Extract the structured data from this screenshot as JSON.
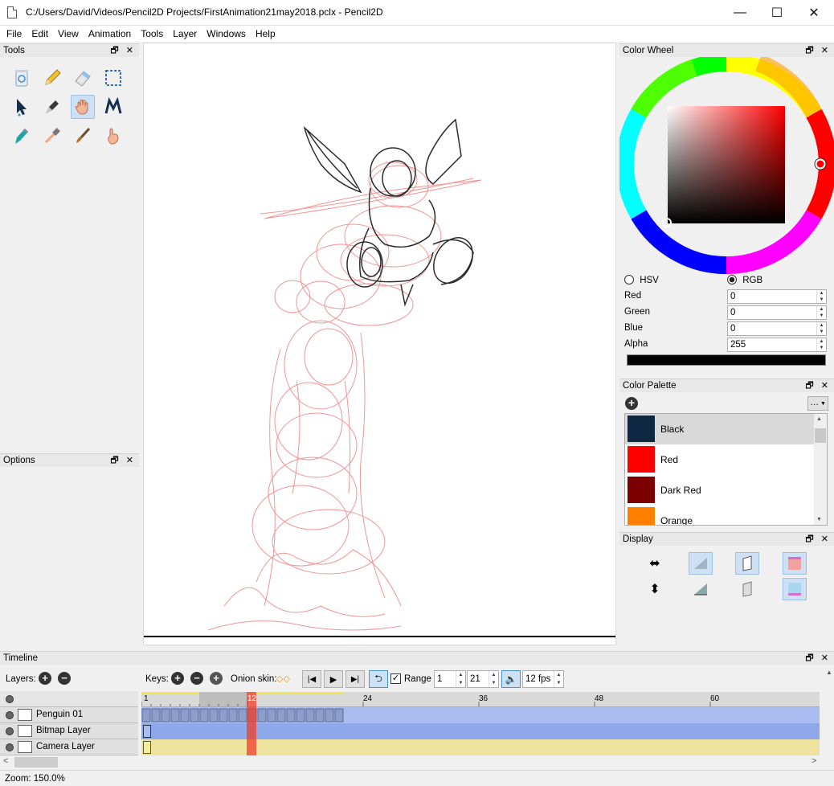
{
  "window": {
    "title": "C:/Users/David/Videos/Pencil2D Projects/FirstAnimation21may2018.pclx - Pencil2D",
    "min_glyph": "—",
    "max_glyph": "☐",
    "close_glyph": "✕"
  },
  "menu": [
    "File",
    "Edit",
    "View",
    "Animation",
    "Tools",
    "Layer",
    "Windows",
    "Help"
  ],
  "panels": {
    "tools": "Tools",
    "options": "Options",
    "color_wheel": "Color Wheel",
    "color_palette": "Color Palette",
    "display": "Display",
    "timeline": "Timeline",
    "float_close": "🗗 ✕"
  },
  "tools": [
    {
      "name": "clear-tool",
      "icon": "trash-icon"
    },
    {
      "name": "pencil-tool",
      "icon": "pencil-icon"
    },
    {
      "name": "eraser-tool",
      "icon": "eraser-icon"
    },
    {
      "name": "select-tool",
      "icon": "marquee-icon"
    },
    {
      "name": "move-tool",
      "icon": "arrow-icon"
    },
    {
      "name": "pen-tool",
      "icon": "pen-nib-icon"
    },
    {
      "name": "hand-tool",
      "icon": "hand-icon",
      "active": true
    },
    {
      "name": "smudge-tool",
      "icon": "smudge-icon"
    },
    {
      "name": "polyline-tool",
      "icon": "polyline-icon"
    },
    {
      "name": "eyedropper-tool",
      "icon": "eyedropper-icon"
    },
    {
      "name": "brush-tool",
      "icon": "brush-icon"
    },
    {
      "name": "smudge-finger-tool",
      "icon": "finger-icon"
    }
  ],
  "color": {
    "hsv_label": "HSV",
    "rgb_label": "RGB",
    "mode": "RGB",
    "fields": [
      {
        "label": "Red",
        "value": "0"
      },
      {
        "label": "Green",
        "value": "0"
      },
      {
        "label": "Blue",
        "value": "0"
      },
      {
        "label": "Alpha",
        "value": "255"
      }
    ],
    "preview": "#000000"
  },
  "palette": {
    "add_glyph": "+",
    "menu_label": "…",
    "items": [
      {
        "name": "Black",
        "color": "#0e2742",
        "selected": true
      },
      {
        "name": "Red",
        "color": "#ff0000"
      },
      {
        "name": "Dark Red",
        "color": "#7d0000"
      },
      {
        "name": "Orange",
        "color": "#ff8000"
      }
    ]
  },
  "timeline": {
    "layers_label": "Layers:",
    "keys_label": "Keys:",
    "onion_label": "Onion skin:",
    "range_label": "Range",
    "range_checked": true,
    "range_start": "1",
    "range_end": "21",
    "fps": "12 fps",
    "current_frame": "12",
    "ruler_ticks": [
      "1",
      "24",
      "36",
      "48",
      "60"
    ],
    "layers": [
      {
        "name": "Penguin 01",
        "type": "vector"
      },
      {
        "name": "Bitmap Layer",
        "type": "bitmap"
      },
      {
        "name": "Camera Layer",
        "type": "camera"
      }
    ]
  },
  "status": {
    "zoom": "Zoom: 150.0%"
  }
}
